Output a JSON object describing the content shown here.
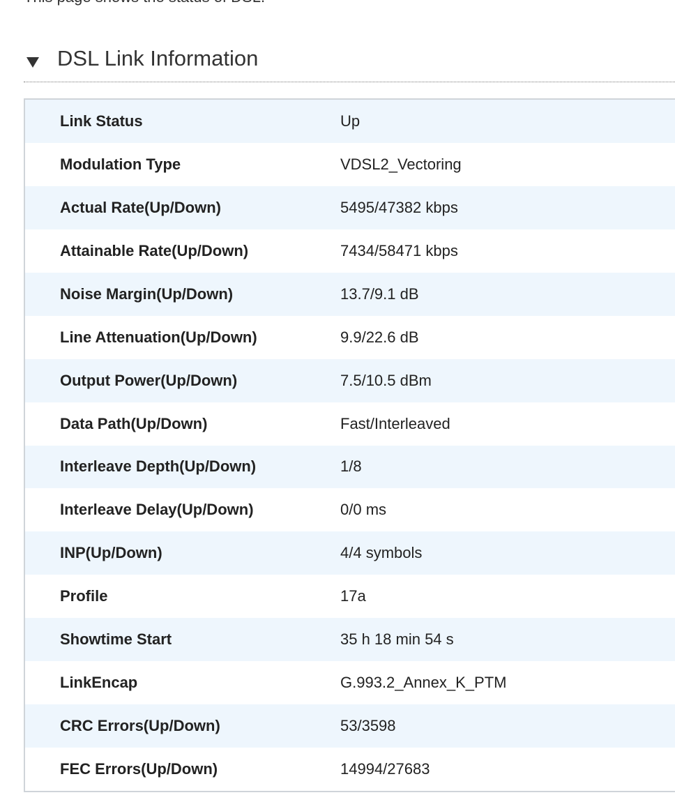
{
  "intro_text": "This page shows the status of DSL.",
  "section": {
    "title": "DSL Link Information",
    "caret_icon": "caret-down-icon"
  },
  "rows": [
    {
      "label": "Link Status",
      "value": "Up"
    },
    {
      "label": "Modulation Type",
      "value": "VDSL2_Vectoring"
    },
    {
      "label": "Actual Rate(Up/Down)",
      "value": "5495/47382 kbps"
    },
    {
      "label": "Attainable Rate(Up/Down)",
      "value": "7434/58471 kbps"
    },
    {
      "label": "Noise Margin(Up/Down)",
      "value": "13.7/9.1 dB"
    },
    {
      "label": "Line Attenuation(Up/Down)",
      "value": "9.9/22.6 dB"
    },
    {
      "label": "Output Power(Up/Down)",
      "value": "7.5/10.5 dBm"
    },
    {
      "label": "Data Path(Up/Down)",
      "value": "Fast/Interleaved"
    },
    {
      "label": "Interleave Depth(Up/Down)",
      "value": "1/8"
    },
    {
      "label": "Interleave Delay(Up/Down)",
      "value": "0/0 ms"
    },
    {
      "label": "INP(Up/Down)",
      "value": "4/4 symbols"
    },
    {
      "label": "Profile",
      "value": "17a"
    },
    {
      "label": "Showtime Start",
      "value": "35 h 18 min 54 s"
    },
    {
      "label": "LinkEncap",
      "value": "G.993.2_Annex_K_PTM"
    },
    {
      "label": "CRC Errors(Up/Down)",
      "value": "53/3598"
    },
    {
      "label": "FEC Errors(Up/Down)",
      "value": "14994/27683"
    }
  ],
  "colors": {
    "row_alt": "#eef6fd",
    "row_base": "#ffffff",
    "table_border": "#cfd4d9",
    "text": "#222222"
  }
}
